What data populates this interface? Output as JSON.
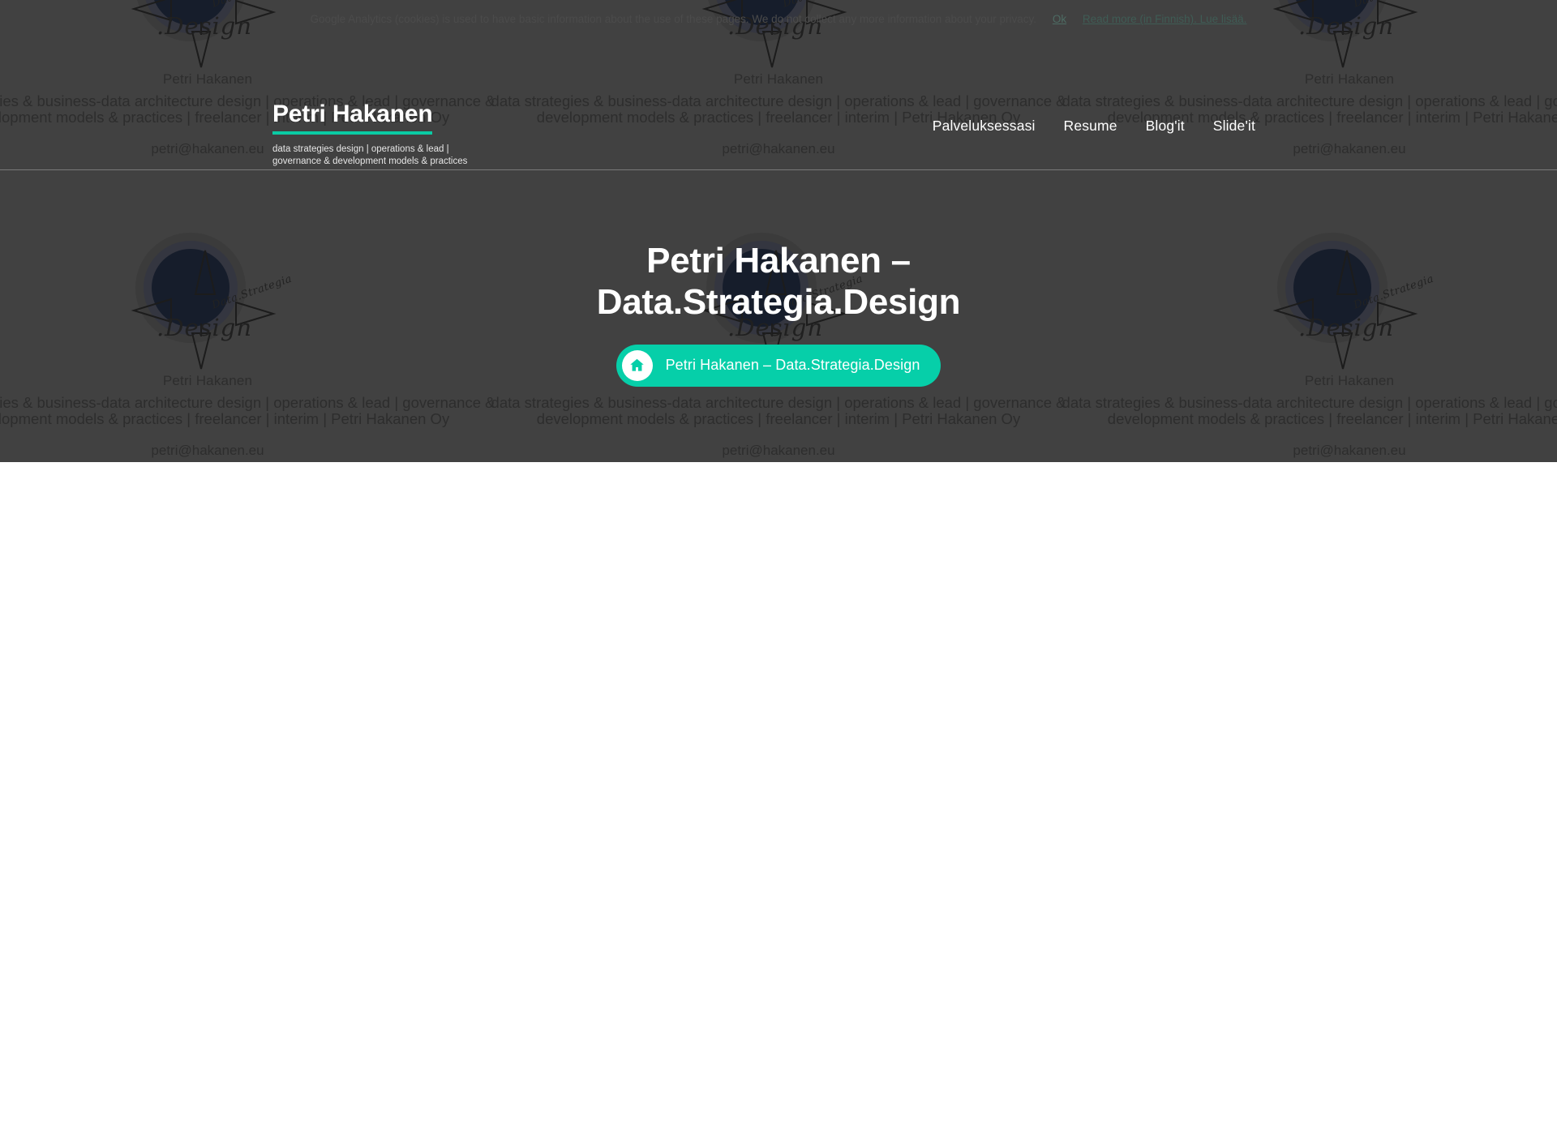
{
  "colors": {
    "accent": "#06CFA9",
    "hero_bg": "#414141",
    "body_bg": "#FFFFFF",
    "nav_text": "#FFFFFF",
    "watermark_text": "#2D2D2D"
  },
  "cookie_notice": {
    "text": "Google Analytics (cookies) is used to have basic information about the use of these pages. We do not collect any more information about your privacy.",
    "ok_label": "Ok",
    "read_more_label": "Read more (in Finnish). Lue lisää."
  },
  "header": {
    "brand_title": "Petri Hakanen",
    "brand_tagline": "data strategies design | operations & lead | governance & development models & practices",
    "nav": [
      {
        "label": "Palveluksessasi"
      },
      {
        "label": "Resume"
      },
      {
        "label": "Blog'it"
      },
      {
        "label": "Slide'it"
      }
    ]
  },
  "hero": {
    "title_line1": "Petri Hakanen –",
    "title_line2": "Data.Strategia.Design",
    "button_label": "Petri Hakanen – Data.Strategia.Design",
    "button_icon": "home-icon"
  },
  "background_watermark": {
    "logo_word_primary": ".Design",
    "logo_word_secondary": "Data.Strategia",
    "name": "Petri Hakanen",
    "tagline_line1": "data strategies & business-data architecture design | operations & lead | governance &",
    "tagline_line2": "development models & practices | freelancer | interim | Petri Hakanen Oy",
    "email": "petri@hakanen.eu"
  }
}
